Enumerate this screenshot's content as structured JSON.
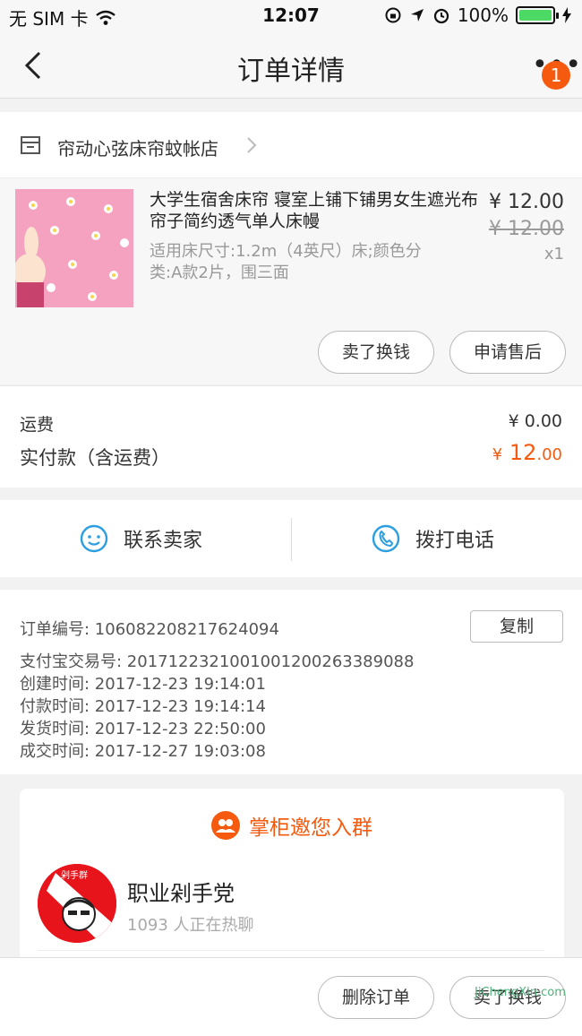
{
  "status_bar": {
    "carrier": "无 SIM 卡",
    "time": "12:07",
    "battery": "100%"
  },
  "nav": {
    "title": "订单详情",
    "badge": "1"
  },
  "store": {
    "name": "帘动心弦床帘蚊帐店"
  },
  "product": {
    "title": "大学生宿舍床帘 寝室上铺下铺男女生遮光布帘子简约透气单人床幔",
    "spec": "适用床尺寸:1.2m（4英尺）床;颜色分类:A款2片，围三面",
    "price": "¥ 12.00",
    "original_price": "¥ 12.00",
    "quantity": "x1",
    "buttons": {
      "sell": "卖了换钱",
      "after_sale": "申请售后"
    }
  },
  "fees": {
    "shipping_label": "运费",
    "shipping_value": "¥ 0.00",
    "paid_label": "实付款（含运费）",
    "paid_currency": "¥",
    "paid_integer": "12",
    "paid_decimal": ".00"
  },
  "contact": {
    "seller": "联系卖家",
    "call": "拨打电话"
  },
  "order_info": {
    "order_no": "订单编号:   106082208217624094",
    "copy_label": "复制",
    "alipay_no": "支付宝交易号:   2017122321001001200263389088",
    "created": "创建时间:   2017-12-23 19:14:01",
    "paid": "付款时间:   2017-12-23 19:14:14",
    "shipped": "发货时间:   2017-12-23 22:50:00",
    "completed": "成交时间:   2017-12-27 19:03:08"
  },
  "group": {
    "header": "掌柜邀您入群",
    "name": "职业剁手党",
    "count": "1093 人正在热聊",
    "avatar_text": "剁手群"
  },
  "bottom": {
    "delete": "删除订单",
    "sell": "卖了换钱"
  },
  "watermark": "JiChengXin.com",
  "colors": {
    "accent": "#f55a0f",
    "contact_icon": "#2d9fe0"
  }
}
